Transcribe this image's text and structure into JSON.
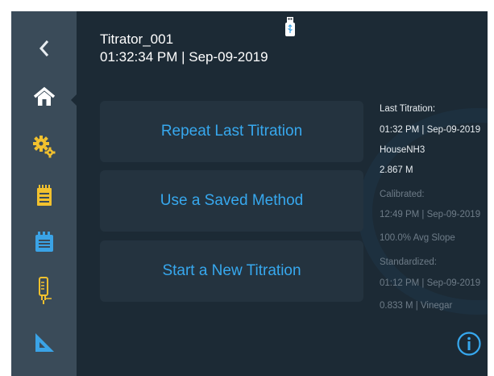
{
  "header": {
    "device_name": "Titrator_001",
    "datetime": "01:32:34 PM | Sep-09-2019"
  },
  "sidebar": {
    "items": [
      {
        "icon": "back-chevron-icon"
      },
      {
        "icon": "home-icon"
      },
      {
        "icon": "settings-gears-icon"
      },
      {
        "icon": "methods-notepad-icon"
      },
      {
        "icon": "results-calendar-icon"
      },
      {
        "icon": "electrode-icon"
      },
      {
        "icon": "ruler-triangle-icon"
      }
    ]
  },
  "buttons": {
    "repeat": "Repeat Last Titration",
    "saved": "Use a Saved Method",
    "new": "Start a New Titration"
  },
  "info": {
    "last_label": "Last Titration:",
    "last_time": "01:32 PM | Sep-09-2019",
    "last_method": "HouseNH3",
    "last_result": "2.867 M",
    "cal_label": "Calibrated:",
    "cal_time": "12:49 PM | Sep-09-2019",
    "cal_slope": "100.0% Avg Slope",
    "std_label": "Standardized:",
    "std_time": "01:12 PM | Sep-09-2019",
    "std_value": "0.833 M | Vinegar"
  },
  "colors": {
    "background": "#1c2a35",
    "sidebar": "#3a4b59",
    "accent": "#37a8ee",
    "button_bg": "#24333f"
  }
}
